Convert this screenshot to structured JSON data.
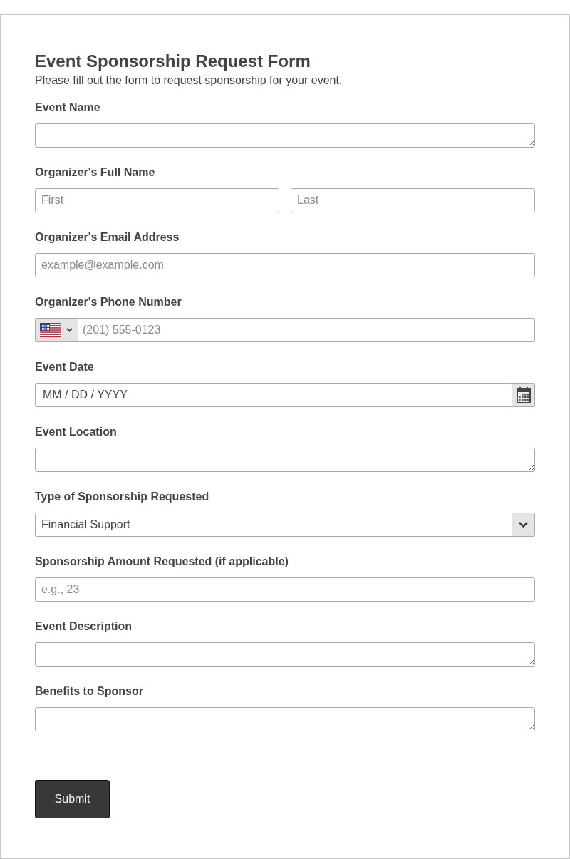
{
  "form": {
    "title": "Event Sponsorship Request Form",
    "description": "Please fill out the form to request sponsorship for your event.",
    "fields": [
      {
        "kind": "textarea",
        "label": "Event Name"
      },
      {
        "kind": "name",
        "label": "Organizer's Full Name",
        "inputs": [
          {
            "placeholder": "First"
          },
          {
            "placeholder": "Last"
          }
        ]
      },
      {
        "kind": "email",
        "label": "Organizer's Email Address",
        "placeholder": "example@example.com"
      },
      {
        "kind": "phone",
        "label": "Organizer's Phone Number",
        "placeholder": "(201) 555-0123"
      },
      {
        "kind": "date",
        "label": "Event Date",
        "placeholder": "MM / DD / YYYY"
      },
      {
        "kind": "textarea",
        "label": "Event Location"
      },
      {
        "kind": "select",
        "label": "Type of Sponsorship Requested",
        "value": "Financial Support"
      },
      {
        "kind": "number",
        "label": "Sponsorship Amount Requested (if applicable)",
        "placeholder": "e.g., 23"
      },
      {
        "kind": "textarea",
        "label": "Event Description"
      },
      {
        "kind": "textarea",
        "label": "Benefits to Sponsor"
      }
    ],
    "submit": "Submit"
  }
}
